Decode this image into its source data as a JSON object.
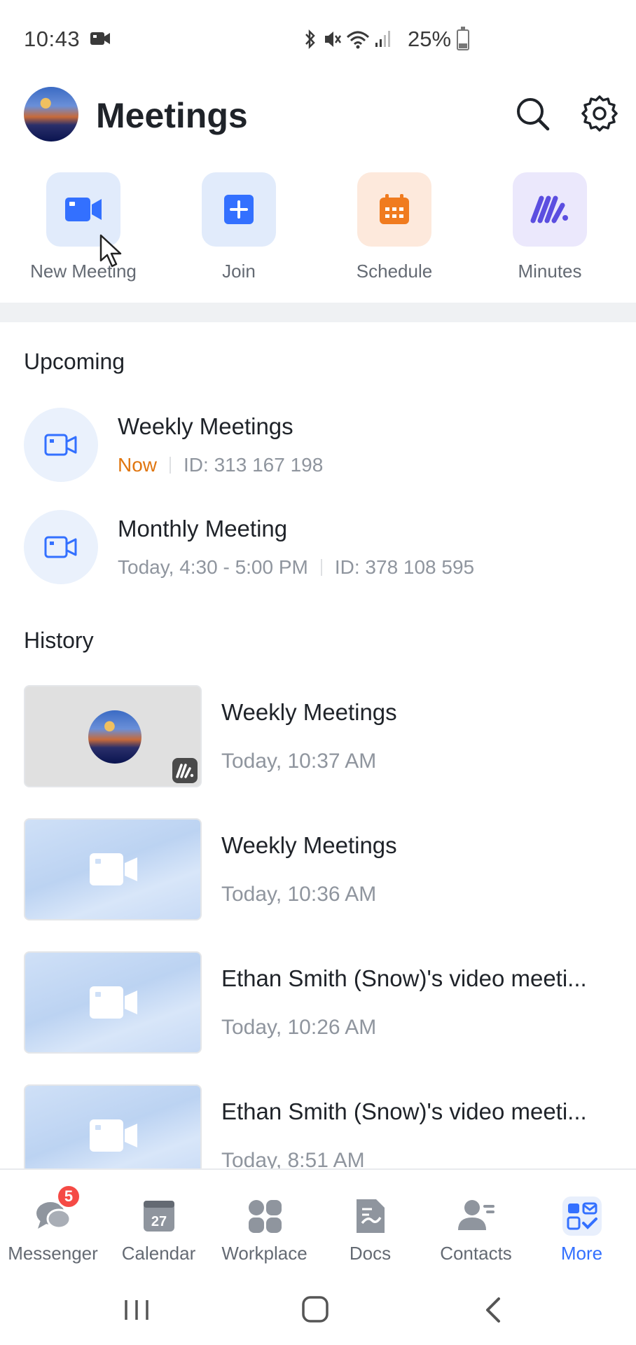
{
  "status_bar": {
    "time": "10:43",
    "battery": "25%",
    "battery_level": 0.25,
    "icons": [
      "video-camera-icon",
      "bluetooth-icon",
      "mute-icon",
      "wifi-icon",
      "signal-icon",
      "battery-icon"
    ]
  },
  "header": {
    "title": "Meetings"
  },
  "actions": [
    {
      "label": "New Meeting",
      "icon": "video-camera-icon",
      "color": "#3370ff"
    },
    {
      "label": "Join",
      "icon": "plus-icon",
      "color": "#3370ff"
    },
    {
      "label": "Schedule",
      "icon": "calendar-icon",
      "color": "#f07b1f"
    },
    {
      "label": "Minutes",
      "icon": "minutes-icon",
      "color": "#5b4ee0"
    }
  ],
  "upcoming": {
    "title": "Upcoming",
    "items": [
      {
        "title": "Weekly Meetings",
        "status": "Now",
        "id": "ID: 313 167 198"
      },
      {
        "title": "Monthly Meeting",
        "time": "Today, 4:30 - 5:00 PM",
        "id": "ID: 378 108 595"
      }
    ]
  },
  "history": {
    "title": "History",
    "items": [
      {
        "title": "Weekly Meetings",
        "time": "Today, 10:37 AM"
      },
      {
        "title": "Weekly Meetings",
        "time": "Today, 10:36 AM"
      },
      {
        "title": "Ethan Smith (Snow)'s video meeti...",
        "time": "Today, 10:26 AM"
      },
      {
        "title": "Ethan Smith (Snow)'s video meeti...",
        "time": "Today, 8:51 AM"
      }
    ]
  },
  "bottom_nav": {
    "items": [
      {
        "label": "Messenger",
        "badge": "5"
      },
      {
        "label": "Calendar",
        "calendar_day": "27"
      },
      {
        "label": "Workplace"
      },
      {
        "label": "Docs"
      },
      {
        "label": "Contacts"
      },
      {
        "label": "More",
        "active": true
      }
    ]
  },
  "colors": {
    "accent": "#3370ff",
    "now": "#e07610",
    "badge": "#f54a45"
  }
}
